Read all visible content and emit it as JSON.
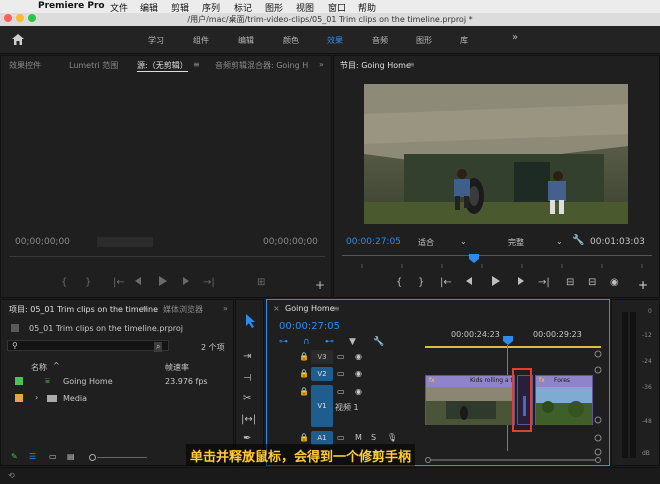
{
  "menubar": {
    "app": "Premiere Pro",
    "items": [
      "文件",
      "编辑",
      "剪辑",
      "序列",
      "标记",
      "图形",
      "视图",
      "窗口",
      "帮助"
    ]
  },
  "window": {
    "title": "/用户/mac/桌面/trim-video-clips/05_01 Trim clips on the timeline.prproj *"
  },
  "workspaces": {
    "tabs": [
      "学习",
      "组件",
      "编辑",
      "颜色",
      "效果",
      "音频",
      "图形",
      "库"
    ],
    "active": "效果",
    "more": "»"
  },
  "source_panel": {
    "tabs": [
      "效果控件",
      "Lumetri 范围",
      "源:（无剪辑）",
      "音频剪辑混合器: Going H"
    ],
    "timecode_left": "00;00;00;00",
    "timecode_right": "00;00;00;00",
    "menu_icon": "≡",
    "more": "»"
  },
  "program_panel": {
    "title": "节目: Going Home",
    "timecode": "00:00:27:05",
    "fit": "适合",
    "quality": "完整",
    "duration": "00:01:03:03"
  },
  "project_panel": {
    "tab": "项目: 05_01 Trim clips on the timeline",
    "tab2": "媒体浏览器",
    "file": "05_01 Trim clips on the timeline.prproj",
    "item_count": "2 个项",
    "columns": [
      "名称",
      "帧速率"
    ],
    "items": [
      {
        "name": "Going Home",
        "rate": "23.976 fps",
        "color": "#4fbf5a"
      },
      {
        "name": "Media",
        "rate": "",
        "color": "#e8a33a"
      }
    ]
  },
  "timeline": {
    "tab": "Going Home",
    "timecode": "00:00:27:05",
    "ruler": [
      "00:00:24:23",
      "00:00:29:23"
    ],
    "tracks": [
      "V3",
      "V2",
      "V1",
      "A1"
    ],
    "v1_name": "视频 1",
    "clips": [
      {
        "label": "Kids rolling a tir"
      },
      {
        "label": "Fores"
      }
    ]
  },
  "audio_meter": {
    "ticks": [
      "0",
      "-12",
      "-24",
      "-36",
      "-48",
      "dB"
    ]
  },
  "caption": "单击并释放鼠标，会得到一个修剪手柄",
  "colors": {
    "accent": "#2d8ceb",
    "clip": "#8f84c9",
    "highlight": "#e53d30",
    "caption": "#ffcc33"
  }
}
